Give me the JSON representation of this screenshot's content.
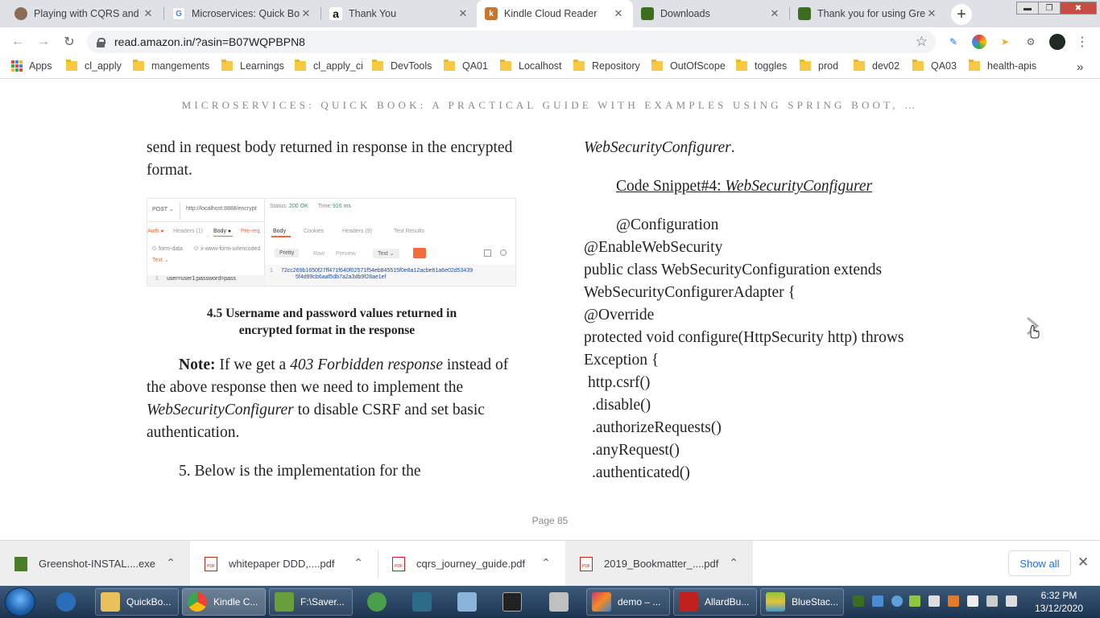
{
  "browser": {
    "tabs": [
      {
        "title": "Playing with CQRS and E",
        "icon": "avatar-favicon",
        "color": "#8a6b55",
        "glyph": ""
      },
      {
        "title": "Microservices: Quick Boo",
        "icon": "google-favicon",
        "color": "#ffffff",
        "glyph": "G"
      },
      {
        "title": "Thank You",
        "icon": "amazon-favicon",
        "color": "#ffffff",
        "glyph": "a"
      },
      {
        "title": "Kindle Cloud Reader",
        "icon": "kindle-favicon",
        "color": "#c9762b",
        "glyph": "k"
      },
      {
        "title": "Downloads",
        "icon": "greenshot-favicon",
        "color": "#3b6e1f",
        "glyph": ""
      },
      {
        "title": "Thank you for using Gre",
        "icon": "greenshot-favicon",
        "color": "#3b6e1f",
        "glyph": ""
      }
    ],
    "tab_close_glyph": "✕",
    "new_tab_glyph": "+",
    "url": "read.amazon.in/?asin=B07WQPBPN8",
    "bookmarks": [
      {
        "label": "Apps"
      },
      {
        "label": "cl_apply"
      },
      {
        "label": "mangements"
      },
      {
        "label": "Learnings"
      },
      {
        "label": "cl_apply_ci"
      },
      {
        "label": "DevTools"
      },
      {
        "label": "QA01"
      },
      {
        "label": "Localhost"
      },
      {
        "label": "Repository"
      },
      {
        "label": "OutOfScope"
      },
      {
        "label": "toggles"
      },
      {
        "label": "prod"
      },
      {
        "label": "dev02"
      },
      {
        "label": "QA03"
      },
      {
        "label": "health-apis"
      }
    ],
    "bookmarks_overflow": "»"
  },
  "reader": {
    "book_title": "MICROSERVICES: QUICK BOOK: A PRACTICAL GUIDE WITH EXAMPLES USING SPRING BOOT, …",
    "left_para1": "send in request body returned in response in the encrypted format.",
    "screenshot": {
      "method": "POST ⌄",
      "url": "http://localhost:8888/encrypt",
      "status_label": "Status:",
      "status": "200 OK",
      "time_label": "Time:",
      "time": "916 ms",
      "req_tabs": [
        "Auth ●",
        "Headers (1)",
        "Body ●",
        "Pre-req."
      ],
      "resp_tabs": [
        "Body",
        "Cookies",
        "Headers (9)",
        "Test Results"
      ],
      "body_opts": [
        "form-data",
        "x-www-form-urlencoded"
      ],
      "text_label": "Text ⌄",
      "view_btns": [
        "Pretty",
        "Raw",
        "Preview",
        "Text ⌄"
      ],
      "req_body": "user=user1;password=pass",
      "resp_line1": "72cc269b1650f27ff471f640f02571f54eb845515f0e8a12acbe61a6e02d53439",
      "resp_line2": "5f4d99cb6aaf5db7a2a3db9f28ae1ef",
      "line_no": "1"
    },
    "caption_line1": "4.5 Username and password values returned in",
    "caption_line2": "encrypted format in the response",
    "note_label": "Note:",
    "note_a": " If we get a ",
    "note_em1": "403 Forbidden response",
    "note_b": " instead of the above response then we need to implement the ",
    "note_em2": "WebSecurityConfigurer",
    "note_c": " to disable CSRF and set basic authentication.",
    "step5": "5. Below is the implementation for the",
    "right_line1": "WebSecurityConfigurer",
    "right_line1_end": ".",
    "snippet_label": "Code Snippet#4: ",
    "snippet_em": "WebSecurityConfigurer",
    "code_lines": [
      "@Configuration",
      "@EnableWebSecurity",
      "public class WebSecurityConfiguration extends",
      "WebSecurityConfigurerAdapter {",
      "@Override",
      "protected void configure(HttpSecurity http) throws",
      "Exception {",
      "http.csrf()",
      ".disable()",
      ".authorizeRequests()",
      ".anyRequest()",
      ".authenticated()"
    ],
    "page_label": "Page 85"
  },
  "downloads": {
    "items": [
      {
        "name": "Greenshot-INSTAL....exe",
        "type": "exe"
      },
      {
        "name": "whitepaper DDD,....pdf",
        "type": "pdf"
      },
      {
        "name": "cqrs_journey_guide.pdf",
        "type": "pdf"
      },
      {
        "name": "2019_Bookmatter_....pdf",
        "type": "pdf"
      }
    ],
    "chevron": "⌃",
    "show_all": "Show all",
    "close_glyph": "✕"
  },
  "taskbar": {
    "items": [
      {
        "label": "",
        "color": "#2a6ebb"
      },
      {
        "label": "QuickBo...",
        "color": "#e8c15a"
      },
      {
        "label": "Kindle C...",
        "color": "#e8e8e8"
      },
      {
        "label": "F:\\Saver...",
        "color": "#6a9e3a"
      },
      {
        "label": "",
        "color": "#4aa04a"
      },
      {
        "label": "",
        "color": "#2d6b8a"
      },
      {
        "label": "",
        "color": "#8ab4d8"
      },
      {
        "label": "",
        "color": "#222222"
      },
      {
        "label": "",
        "color": "#c0c0c0"
      },
      {
        "label": "demo – ...",
        "color": "#d23c6f"
      },
      {
        "label": "AllardBu...",
        "color": "#c0211f"
      },
      {
        "label": "BlueStac...",
        "color": "#8fc641"
      }
    ],
    "time": "6:32 PM",
    "date": "13/12/2020"
  }
}
